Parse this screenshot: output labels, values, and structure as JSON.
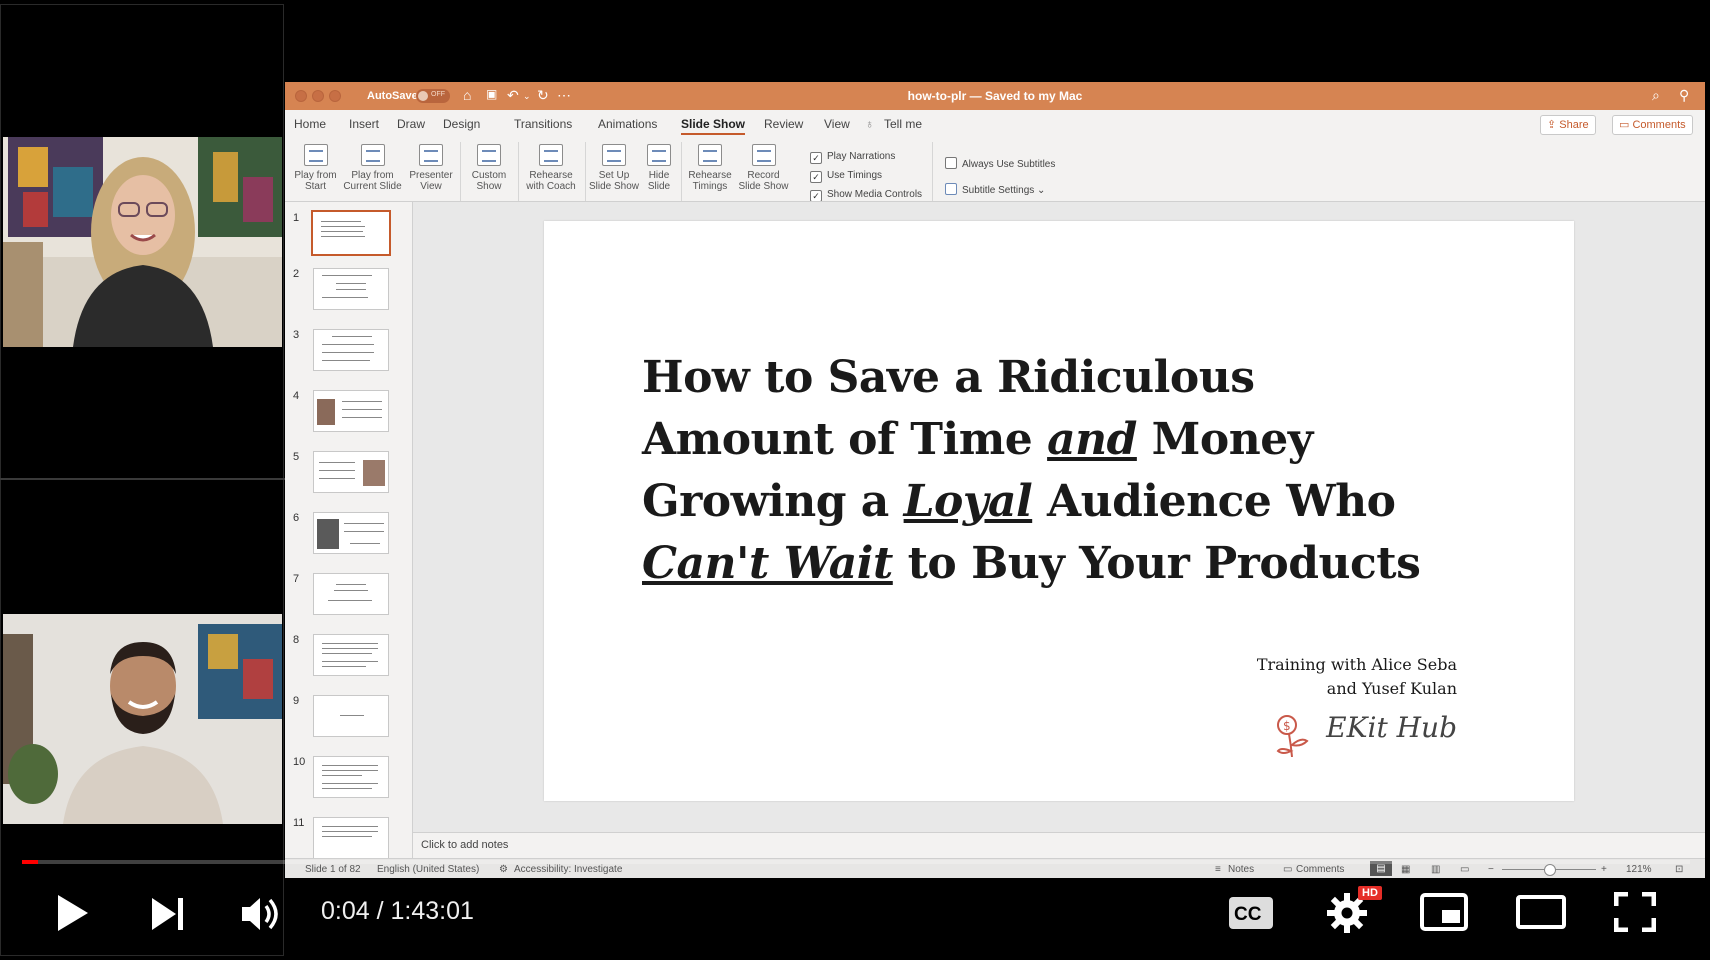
{
  "player": {
    "time_display": "0:04 / 1:43:01",
    "progress": 0.0006,
    "hd_badge": "HD",
    "buttons": [
      "play",
      "next",
      "volume",
      "captions",
      "settings",
      "miniplayer",
      "theater",
      "fullscreen"
    ]
  },
  "window": {
    "title": "how-to-plr — Saved to my Mac",
    "autosave_label": "AutoSave",
    "autosave_state": "OFF"
  },
  "tabs": [
    {
      "label": "Home"
    },
    {
      "label": "Insert"
    },
    {
      "label": "Draw"
    },
    {
      "label": "Design"
    },
    {
      "label": "Transitions"
    },
    {
      "label": "Animations"
    },
    {
      "label": "Slide Show",
      "active": true
    },
    {
      "label": "Review"
    },
    {
      "label": "View"
    },
    {
      "label": "Tell me"
    }
  ],
  "top_right": {
    "share": "Share",
    "comments": "Comments"
  },
  "ribbon": {
    "play_from_start": [
      "Play from",
      "Start"
    ],
    "play_current": [
      "Play from",
      "Current Slide"
    ],
    "presenter_view": [
      "Presenter",
      "View"
    ],
    "custom_show": [
      "Custom",
      "Show"
    ],
    "rehearse_coach": [
      "Rehearse",
      "with Coach"
    ],
    "set_up": [
      "Set Up",
      "Slide Show"
    ],
    "hide_slide": [
      "Hide",
      "Slide"
    ],
    "rehearse_timings": [
      "Rehearse",
      "Timings"
    ],
    "record": [
      "Record",
      "Slide Show"
    ],
    "play_narrations": "Play Narrations",
    "use_timings": "Use Timings",
    "show_media": "Show Media Controls",
    "always_subtitles": "Always Use Subtitles",
    "subtitle_settings": "Subtitle Settings"
  },
  "thumbnails": [
    "1",
    "2",
    "3",
    "4",
    "5",
    "6",
    "7",
    "8",
    "9",
    "10",
    "11"
  ],
  "slide": {
    "line1": "How to Save a Ridiculous",
    "line2_a": "Amount of Time ",
    "line2_b": "and",
    "line2_c": " Money",
    "line3_a": "Growing a ",
    "line3_b": "Loyal",
    "line3_c": " Audience Who",
    "line4_a": "Can't Wait",
    "line4_b": " to Buy Your Products",
    "credit1": "Training with Alice Seba",
    "credit2": "and Yusef Kulan",
    "brand": "EKit Hub"
  },
  "notes_placeholder": "Click to add notes",
  "status": {
    "slide_count": "Slide 1 of 82",
    "language": "English (United States)",
    "accessibility": "Accessibility: Investigate",
    "notes": "Notes",
    "comments": "Comments",
    "zoom": "121%"
  },
  "colors": {
    "titlebar": "#d68452",
    "accent": "#c55a2b",
    "progress": "#ff0000"
  }
}
